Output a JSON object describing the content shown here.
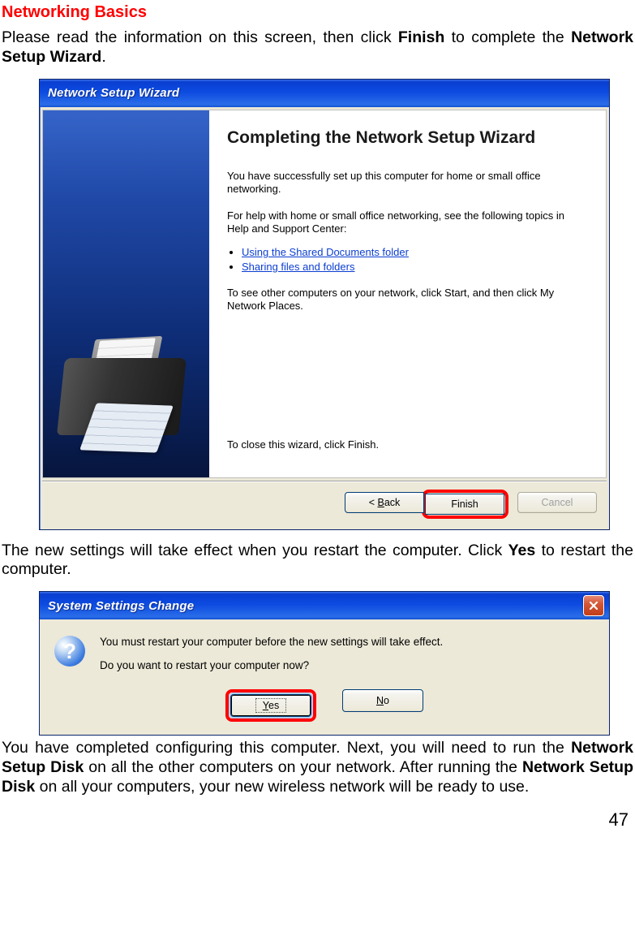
{
  "section_title": "Networking Basics",
  "intro_pre": "Please read the information on this screen, then click ",
  "intro_bold1": "Finish",
  "intro_mid": " to complete the ",
  "intro_bold2": "Network Setup Wizard",
  "intro_post": ".",
  "wizard": {
    "title": "Network Setup Wizard",
    "heading": "Completing the Network Setup Wizard",
    "p1": "You have successfully set up this computer for home or small office networking.",
    "p2": "For help with home or small office networking, see the following topics in Help and Support Center:",
    "link1": "Using the Shared Documents folder",
    "link2": "Sharing files and folders",
    "p3": "To see other computers on your network, click Start, and then click My Network Places.",
    "footer": "To close this wizard, click Finish.",
    "buttons": {
      "back": "< Back",
      "finish": "Finish",
      "cancel": "Cancel"
    }
  },
  "mid_pre": "The new settings will take effect when you restart the computer. Click ",
  "mid_bold": "Yes",
  "mid_post": " to restart the computer.",
  "dialog": {
    "title": "System Settings Change",
    "line1": "You must restart your computer before the new settings will take effect.",
    "line2": "Do you want to restart your computer now?",
    "yes": "Yes",
    "no": "No"
  },
  "outro_1": "You have completed configuring this computer. Next, you will need to run the ",
  "outro_b1": "Network Setup Disk",
  "outro_2": " on all the other computers on your network.  After run­ning the ",
  "outro_b2": "Network Setup Disk",
  "outro_3": " on all your computers, your new wireless net­work will be ready to use.",
  "page_number": "47"
}
